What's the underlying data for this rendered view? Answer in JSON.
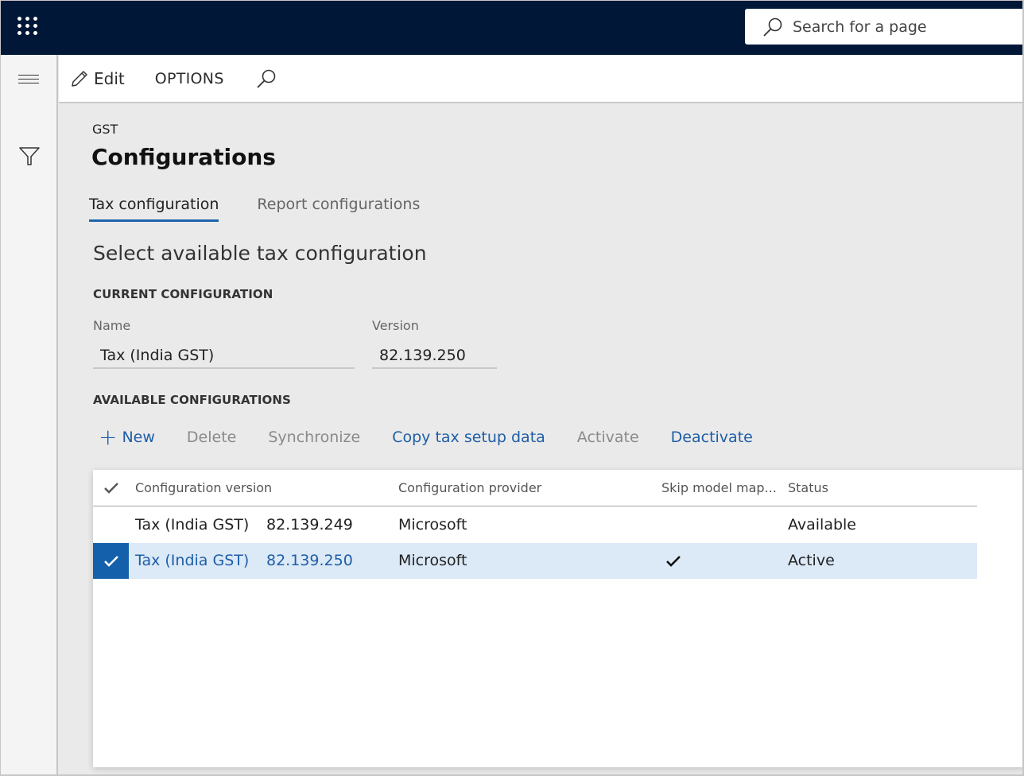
{
  "topbar": {
    "search_placeholder": "Search for a page"
  },
  "actionpane": {
    "edit_label": "Edit",
    "options_label": "OPTIONS"
  },
  "page": {
    "breadcrumb": "GST",
    "title": "Configurations",
    "tabs": [
      {
        "label": "Tax configuration",
        "active": true
      },
      {
        "label": "Report configurations",
        "active": false
      }
    ],
    "section_title": "Select available tax configuration"
  },
  "current": {
    "heading": "CURRENT CONFIGURATION",
    "name_label": "Name",
    "name_value": "Tax (India GST)",
    "version_label": "Version",
    "version_value": "82.139.250"
  },
  "available": {
    "heading": "AVAILABLE CONFIGURATIONS",
    "toolbar": [
      {
        "label": "New",
        "enabled": true,
        "icon": "plus-icon"
      },
      {
        "label": "Delete",
        "enabled": false
      },
      {
        "label": "Synchronize",
        "enabled": false
      },
      {
        "label": "Copy tax setup data",
        "enabled": true
      },
      {
        "label": "Activate",
        "enabled": false
      },
      {
        "label": "Deactivate",
        "enabled": true
      }
    ],
    "columns": [
      "Configuration version",
      "Configuration provider",
      "Skip model map...",
      "Status"
    ],
    "rows": [
      {
        "name": "Tax (India GST)",
        "version": "82.139.249",
        "provider": "Microsoft",
        "skip_model_mapping": false,
        "status": "Available",
        "selected": false
      },
      {
        "name": "Tax (India GST)",
        "version": "82.139.250",
        "provider": "Microsoft",
        "skip_model_mapping": true,
        "status": "Active",
        "selected": true
      }
    ]
  },
  "colors": {
    "nav_bar": "#001737",
    "accent": "#1e5ea7",
    "selected_row": "#dce9f7",
    "selected_marker": "#1460aa"
  }
}
